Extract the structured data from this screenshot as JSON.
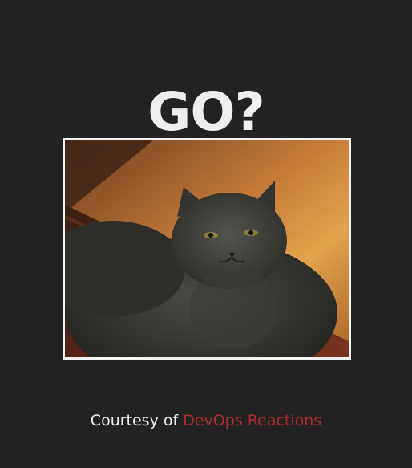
{
  "headline": "GO?",
  "image": {
    "alt": "Grey cat staring at the camera",
    "subject": "cat-photo"
  },
  "footer": {
    "prefix": "Courtesy of",
    "link_text": "DevOps Reactions"
  },
  "colors": {
    "background": "#222222",
    "headline": "#eeeeee",
    "link": "#b22a34",
    "frame": "#f4f4f4"
  }
}
